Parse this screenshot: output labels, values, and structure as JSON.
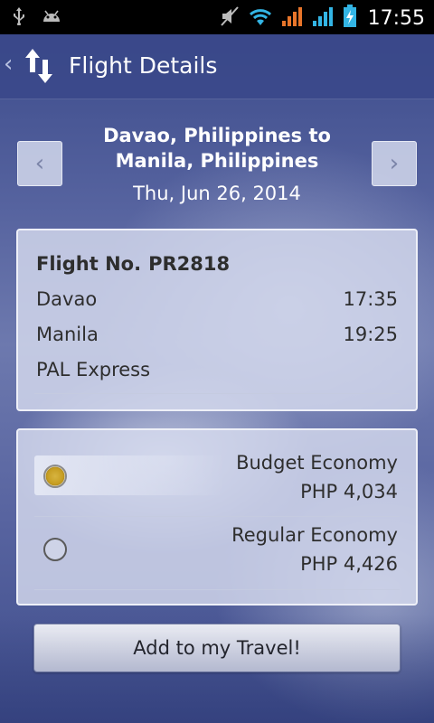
{
  "status_bar": {
    "time": "17:55",
    "icons": [
      "usb-icon",
      "android-debug-icon",
      "mute-icon",
      "wifi-icon",
      "signal-icon",
      "signal-icon",
      "battery-charging-icon"
    ]
  },
  "header": {
    "title": "Flight Details",
    "back_glyph": "‹",
    "logo_icon": "arrows-up-down-icon"
  },
  "route": {
    "line1": "Davao, Philippines to",
    "line2": "Manila, Philippines",
    "date": "Thu, Jun 26, 2014",
    "prev_glyph": "‹",
    "next_glyph": "›"
  },
  "flight": {
    "number_label": "Flight No.",
    "number": "PR2818",
    "origin": "Davao",
    "departure": "17:35",
    "destination": "Manila",
    "arrival": "19:25",
    "airline": "PAL Express"
  },
  "fares": [
    {
      "name": "Budget Economy",
      "price": "PHP 4,034",
      "selected": true
    },
    {
      "name": "Regular Economy",
      "price": "PHP 4,426",
      "selected": false
    }
  ],
  "actions": {
    "add_label": "Add to my Travel!"
  },
  "colors": {
    "header_bg": "#3a488a",
    "card_bg": "#d6dbee",
    "radio_selected": "#d7b440"
  }
}
